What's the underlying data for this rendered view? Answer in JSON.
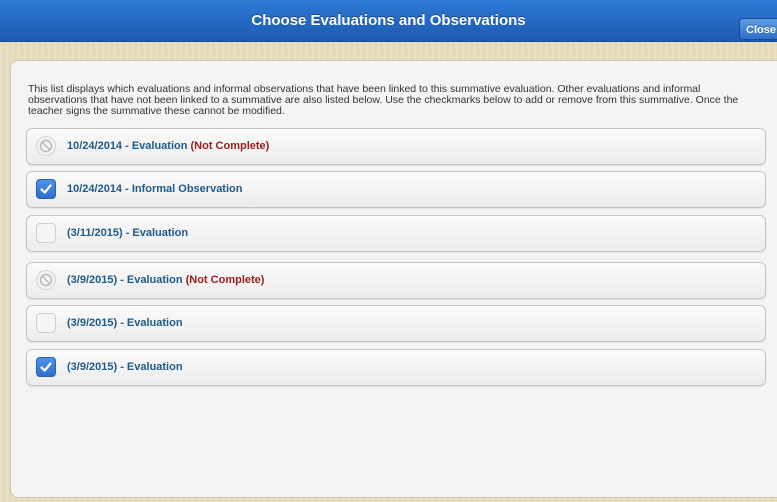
{
  "window": {
    "title": "Choose Evaluations and Observations",
    "close_label": "Close"
  },
  "intro_text": "This list displays which evaluations and informal observations that have been linked to this summative evaluation. Other evaluations and informal observations that have not been linked to a summative are also listed below. Use the checkmarks below to add or remove from this summative. Once the teacher signs the summative these cannot be modified.",
  "items": [
    {
      "label": "10/24/2014 - Evaluation",
      "status": "(Not Complete)",
      "state": "disabled"
    },
    {
      "label": "10/24/2014 - Informal Observation",
      "status": "",
      "state": "checked"
    },
    {
      "label": "(3/11/2015) - Evaluation",
      "status": "",
      "state": "unchecked"
    },
    {
      "label": "(3/9/2015) - Evaluation",
      "status": "(Not Complete)",
      "state": "disabled"
    },
    {
      "label": "(3/9/2015) - Evaluation",
      "status": "",
      "state": "unchecked"
    },
    {
      "label": "(3/9/2015) - Evaluation",
      "status": "",
      "state": "checked"
    }
  ],
  "colors": {
    "titlebar": "#2569c2",
    "label": "#1e5a8a",
    "not_complete": "#9b1c1c",
    "check": "#2a6fcf"
  }
}
